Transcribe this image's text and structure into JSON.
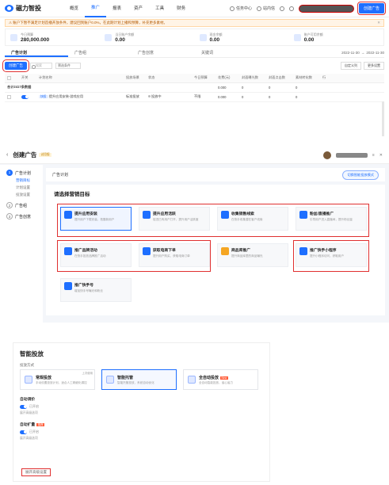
{
  "panel1": {
    "logo_text": "磁力智投",
    "nav": [
      "概览",
      "推广",
      "报表",
      "资产",
      "工具",
      "财务"
    ],
    "nav_active_index": 1,
    "top_right": {
      "task_center": "任务中心",
      "msg": "站内信",
      "help": "帮助",
      "settings": "设置"
    },
    "create_button": "创建广告",
    "warning": "账户下暂不满足计划首播开放条件，建议回到账户0.0%，在此期计划上播和预算，补充更多素材。",
    "stats": [
      {
        "label": "今日预算",
        "value": "280,000.000"
      },
      {
        "label": "当日账户余额",
        "value": "0.00"
      },
      {
        "label": "现金余额",
        "value": "0.00"
      },
      {
        "label": "账户可用余额",
        "value": "0.00"
      }
    ],
    "tabs": [
      "广告计划",
      "广告组",
      "广告创意",
      "关键词"
    ],
    "date_start": "2022-11-30",
    "date_end": "2022-11-30",
    "toolbar": {
      "create": "创建广告",
      "search_placeholder": "搜索",
      "filter": "筛选条件",
      "custom_cols": "自定义列",
      "more_settings": "更多设置"
    },
    "table_headers": [
      "",
      "开关",
      "计划名称",
      "",
      "投放场景",
      "状态",
      "",
      "今日预算",
      "花费(元)",
      "封面曝光数",
      "封面点击数",
      "素材转化数",
      "行"
    ],
    "summary_row": "合计2417条数据",
    "row": {
      "name": "提升应用安装-游戏应用",
      "tag": "快投",
      "scene": "标准投放",
      "status": "投放中",
      "budget": "不限",
      "cost": "0.000",
      "v1": "0",
      "v2": "0",
      "v3": "0"
    }
  },
  "panel2": {
    "title": "创建广告",
    "badge": "试用版",
    "sidebar": [
      {
        "no": "1",
        "label": "广告计划",
        "subs": [
          "营销目标",
          "计划设置",
          "投放设置"
        ]
      },
      {
        "no": "2",
        "label": "广告组",
        "subs": []
      },
      {
        "no": "3",
        "label": "广告创意",
        "subs": []
      }
    ],
    "header_label": "广告计划",
    "smart_mode_button": "切换智能投放模式",
    "section_title": "请选择营销目标",
    "goals": [
      {
        "title": "提升应用安装",
        "desc": "提升用户下载安装，拓展新用户"
      },
      {
        "title": "提升应用活跃",
        "desc": "促进已有用户打开，提升用户活跃度"
      },
      {
        "title": "收集销售线索",
        "desc": "在快手收集潜在客户线索"
      },
      {
        "title": "粉丝/直播推广",
        "desc": "引导用户进入直播间，提升粉丝量"
      },
      {
        "title": "推广品牌活动",
        "desc": "在快手投放品牌推广活动"
      },
      {
        "title": "获取电商下单",
        "desc": "提升用户购买，获取电商订单"
      },
      {
        "title": "商品库推广",
        "desc": "提升商品库里的商品曝光"
      },
      {
        "title": "推广快手小程序",
        "desc": "提升小程序访问，获取用户"
      },
      {
        "title": "推广快手号",
        "desc": "增加快手号曝光和粉丝"
      }
    ]
  },
  "panel3": {
    "title": "智能投放",
    "mode_label": "投放方式",
    "modes": [
      {
        "title": "常规投放",
        "desc": "手动设置投放计划，适合人工精细化调控",
        "tag": "",
        "last": "上次使用"
      },
      {
        "title": "智能托管",
        "desc": "智能托管投放，系统自动优化",
        "tag": "",
        "last": ""
      },
      {
        "title": "全自动投放",
        "desc": "全自动智能投放，省心省力",
        "tag": "New",
        "last": ""
      }
    ],
    "opt1": {
      "title": "自动调价",
      "toggle_label": "已开启",
      "sub": "展开高级选项"
    },
    "opt2": {
      "title": "自动扩量",
      "hot": "推荐",
      "toggle_label": "已开启",
      "sub": "展开高级选项"
    },
    "more": "展开高级设置"
  }
}
